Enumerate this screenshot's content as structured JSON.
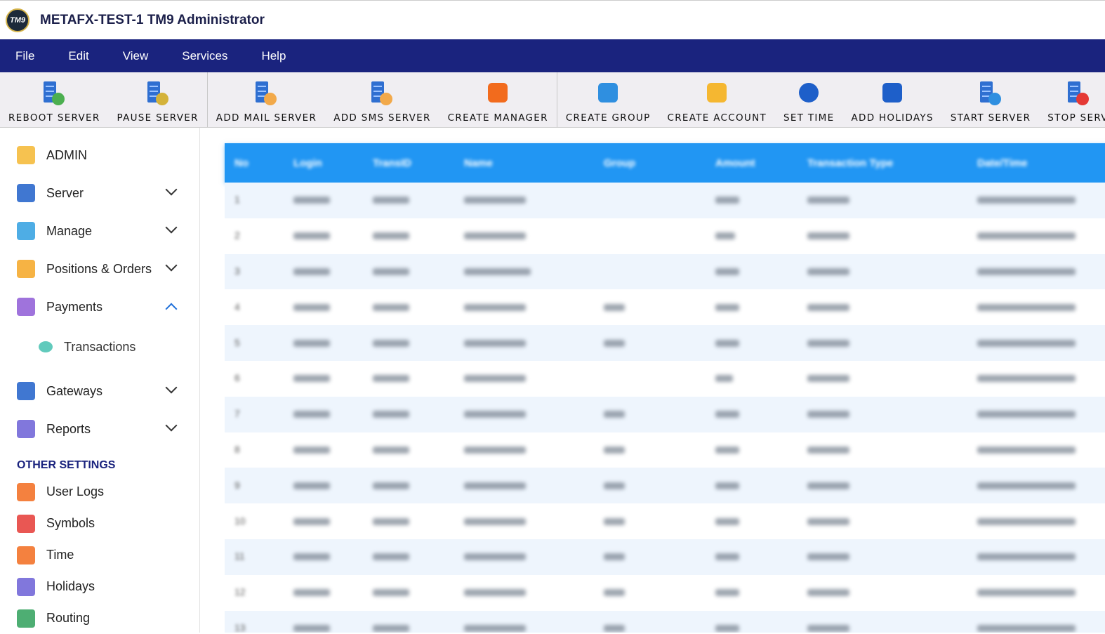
{
  "window": {
    "title": "METAFX-TEST-1 TM9 Administrator",
    "logo_text": "TM9"
  },
  "menu": [
    "File",
    "Edit",
    "View",
    "Services",
    "Help"
  ],
  "toolbar": [
    {
      "label": "REBOOT SERVER",
      "icon": "reboot-server-icon",
      "color": "#4caf50"
    },
    {
      "label": "PAUSE SERVER",
      "icon": "pause-server-icon",
      "color": "#d4b23a"
    },
    {
      "label": "ADD MAIL SERVER",
      "icon": "mail-server-icon",
      "color": "#f2a94a"
    },
    {
      "label": "ADD SMS SERVER",
      "icon": "sms-server-icon",
      "color": "#f2a94a"
    },
    {
      "label": "CREATE MANAGER",
      "icon": "manager-icon",
      "color": "#f26b1d"
    },
    {
      "label": "CREATE GROUP",
      "icon": "group-icon",
      "color": "#2f8fe0"
    },
    {
      "label": "CREATE ACCOUNT",
      "icon": "account-icon",
      "color": "#f5b731"
    },
    {
      "label": "SET TIME",
      "icon": "clock-icon",
      "color": "#1e5fc9"
    },
    {
      "label": "ADD HOLIDAYS",
      "icon": "calendar-icon",
      "color": "#1e5fc9"
    },
    {
      "label": "START SERVER",
      "icon": "start-server-icon",
      "color": "#2f8fe0"
    },
    {
      "label": "STOP SERV",
      "icon": "stop-server-icon",
      "color": "#e53935"
    }
  ],
  "sidebar": {
    "items": [
      {
        "label": "ADMIN",
        "icon": "admin-icon",
        "color": "#f5b731",
        "chevron": "none"
      },
      {
        "label": "Server",
        "icon": "server-icon",
        "color": "#1e5fc9",
        "chevron": "down"
      },
      {
        "label": "Manage",
        "icon": "manage-icon",
        "color": "#2f9fe0",
        "chevron": "down"
      },
      {
        "label": "Positions & Orders",
        "icon": "positions-icon",
        "color": "#f5a623",
        "chevron": "down"
      },
      {
        "label": "Payments",
        "icon": "payments-icon",
        "color": "#8e5bd6",
        "chevron": "up"
      }
    ],
    "sub_item": {
      "label": "Transactions",
      "icon": "transactions-icon",
      "color": "#45c1b0"
    },
    "items2": [
      {
        "label": "Gateways",
        "icon": "gateways-icon",
        "color": "#1e5fc9",
        "chevron": "down"
      },
      {
        "label": "Reports",
        "icon": "reports-icon",
        "color": "#6b5fd6",
        "chevron": "down"
      }
    ],
    "section_title": "OTHER SETTINGS",
    "other": [
      {
        "label": "User Logs",
        "icon": "user-logs-icon",
        "color": "#f26b1d"
      },
      {
        "label": "Symbols",
        "icon": "symbols-icon",
        "color": "#e53935"
      },
      {
        "label": "Time",
        "icon": "time-icon",
        "color": "#f26b1d"
      },
      {
        "label": "Holidays",
        "icon": "holidays-icon",
        "color": "#6b5fd6"
      },
      {
        "label": "Routing",
        "icon": "routing-icon",
        "color": "#2fa05a"
      }
    ]
  },
  "table": {
    "headers": [
      "No",
      "Login",
      "TransID",
      "Name",
      "Group",
      "Amount",
      "Transaction Type",
      "Date/Time"
    ],
    "row_numbers": [
      "1",
      "2",
      "3",
      "4",
      "5",
      "6",
      "7",
      "8",
      "9",
      "10",
      "11",
      "12",
      "13"
    ],
    "accent": "#2196f3"
  }
}
